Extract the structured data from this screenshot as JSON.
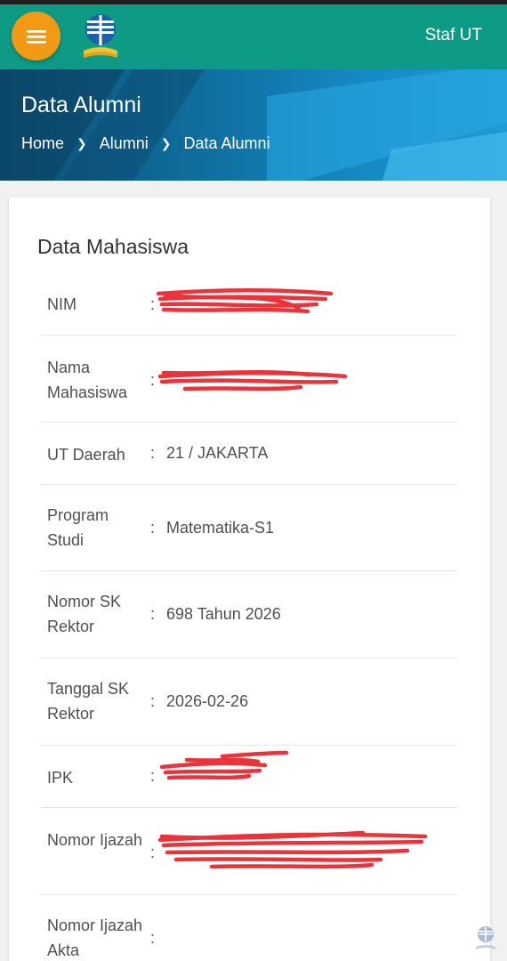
{
  "header": {
    "user_label": "Staf UT"
  },
  "banner": {
    "title": "Data Alumni",
    "breadcrumb": [
      "Home",
      "Alumni",
      "Data Alumni"
    ]
  },
  "card": {
    "title": "Data Mahasiswa",
    "rows": [
      {
        "label": "NIM",
        "value": ""
      },
      {
        "label": "Nama Mahasiswa",
        "value": ""
      },
      {
        "label": "UT Daerah",
        "value": "21 / JAKARTA"
      },
      {
        "label": "Program Studi",
        "value": "Matematika-S1"
      },
      {
        "label": "Nomor SK Rektor",
        "value": "698 Tahun 2026"
      },
      {
        "label": "Tanggal SK Rektor",
        "value": "2026-02-26"
      },
      {
        "label": "IPK",
        "value": ""
      },
      {
        "label": "Nomor Ijazah",
        "value": ""
      },
      {
        "label": "Nomor Ijazah Akta",
        "value": ""
      }
    ]
  },
  "colors": {
    "topbar": "#0e9b86",
    "menu_button": "#f39a14",
    "redaction": "#e8343a"
  },
  "icons": {
    "menu": "hamburger-icon",
    "logo": "university-logo-icon",
    "breadcrumb_separator": "chevron-right-icon"
  }
}
